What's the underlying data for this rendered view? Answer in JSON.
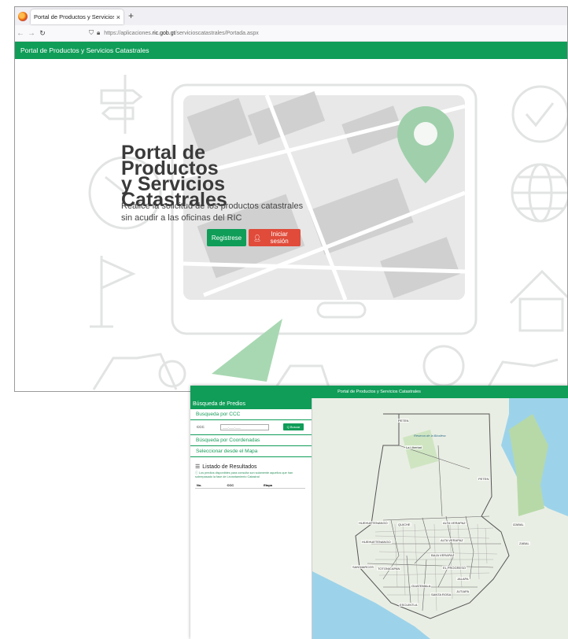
{
  "browser": {
    "tab_title": "Portal de Productos y Servicios Cata",
    "tab_close": "×",
    "new_tab": "+",
    "url_prefix": "https://aplicaciones.",
    "url_domain": "ric.gob.gt",
    "url_suffix": "/servicioscatastrales/Portada.aspx"
  },
  "app_title": "Portal de Productos y Servicios Catastrales",
  "hero": {
    "title_line1": "Portal de Productos",
    "title_line2": "y Servicios",
    "title_line3": "Catastrales",
    "subtitle_line1": "Realice la solicitud de los productos catastrales",
    "subtitle_line2": "sin acudir a las oficinas del RIC",
    "register_label": "Registrese",
    "login_label": "Iniciar sesión"
  },
  "window2": {
    "title": "Portal de Productos y Servicios Catastrales",
    "sidebar": {
      "header": "Búsqueda de Predios",
      "search_ccc": "Busqueda por CCC",
      "ccc_label": "CCC",
      "ccc_placeholder": "___-___-___",
      "search_button": "Q Buscar",
      "search_coords": "Búsqueda por Coordenadas",
      "select_map": "Seleccionar desde el Mapa",
      "results_title": "Listado de Resultados",
      "results_note": "Los predios disponibles para consulta son solamente aquellos que han sobrepasado la fase de Levantamiento Catastral",
      "columns": [
        "No.",
        "CCC",
        "Etapa"
      ]
    },
    "map_labels": {
      "peten_1": "PETEN",
      "peten_2": "PETEN",
      "huehue_1": "HUEHUETENANGO",
      "quiche_1": "QUICHE",
      "alta_verapaz_1": "ALTA VERAPAZ",
      "izabal": "IZABAL",
      "huehue_2": "HUEHUETENANGO",
      "alta_verapaz_2": "ALTA VERAPAZ",
      "zabal": "ZABAL",
      "baja_verapaz": "BAJA VERAPAZ",
      "san_marcos": "SAN MARCOS",
      "totonicapan": "TOTONICAPAN",
      "el_progreso": "EL PROGRESO",
      "jalapa": "JALAPA",
      "jutiapa": "JUTIAPA",
      "santa_rosa": "SANTA ROSA",
      "escuintla": "ESCUINTLA",
      "guatemala": "GUATEMALA",
      "la_libertad": "La Libertad",
      "reserva": "Reserva de la Biosfera"
    }
  },
  "colors": {
    "brand_green": "#0f9d58",
    "login_red": "#e04b3a",
    "map_land": "#e9eee4",
    "map_water": "#9cd3ea"
  }
}
